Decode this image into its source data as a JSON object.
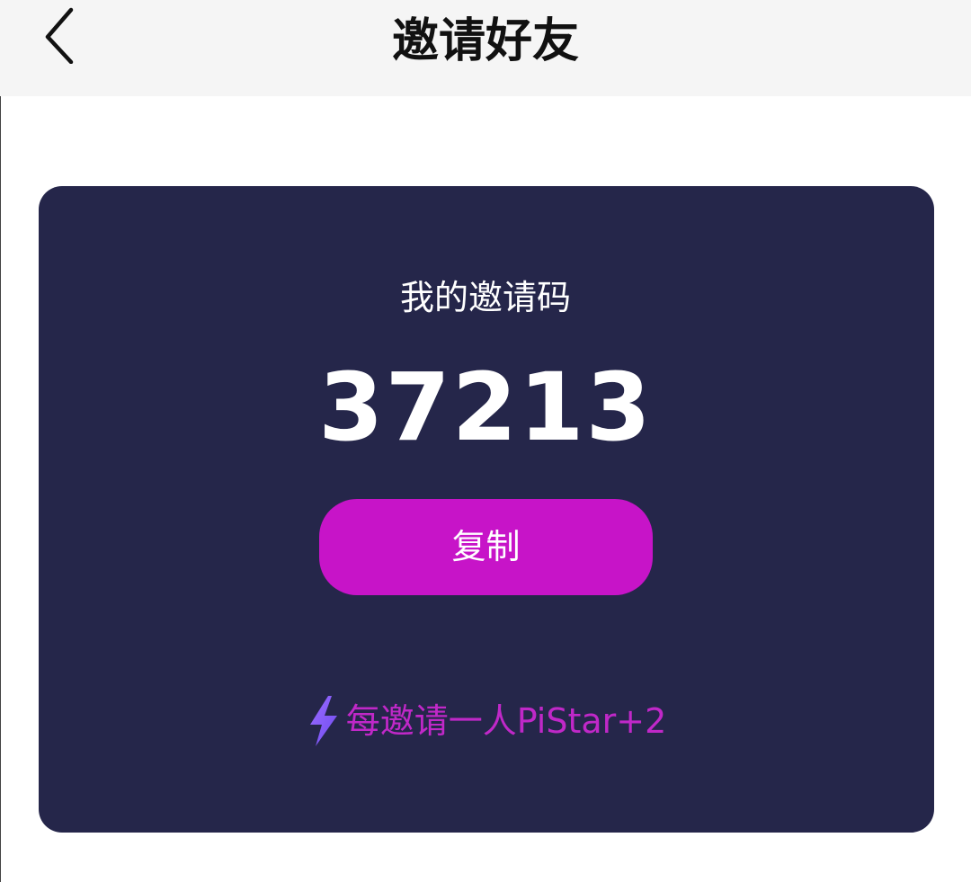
{
  "header": {
    "title": "邀请好友",
    "back_icon": "chevron-left-icon"
  },
  "card": {
    "label": "我的邀请码",
    "code": "37213",
    "copy_button_label": "复制",
    "reward_icon": "lightning-bolt-icon",
    "reward_text": "每邀请一人PiStar+2"
  },
  "colors": {
    "header_bg": "#f5f5f5",
    "card_bg": "#25264a",
    "accent": "#c714c8",
    "reward_text": "#c028c8",
    "bolt": "#8a5cff"
  }
}
